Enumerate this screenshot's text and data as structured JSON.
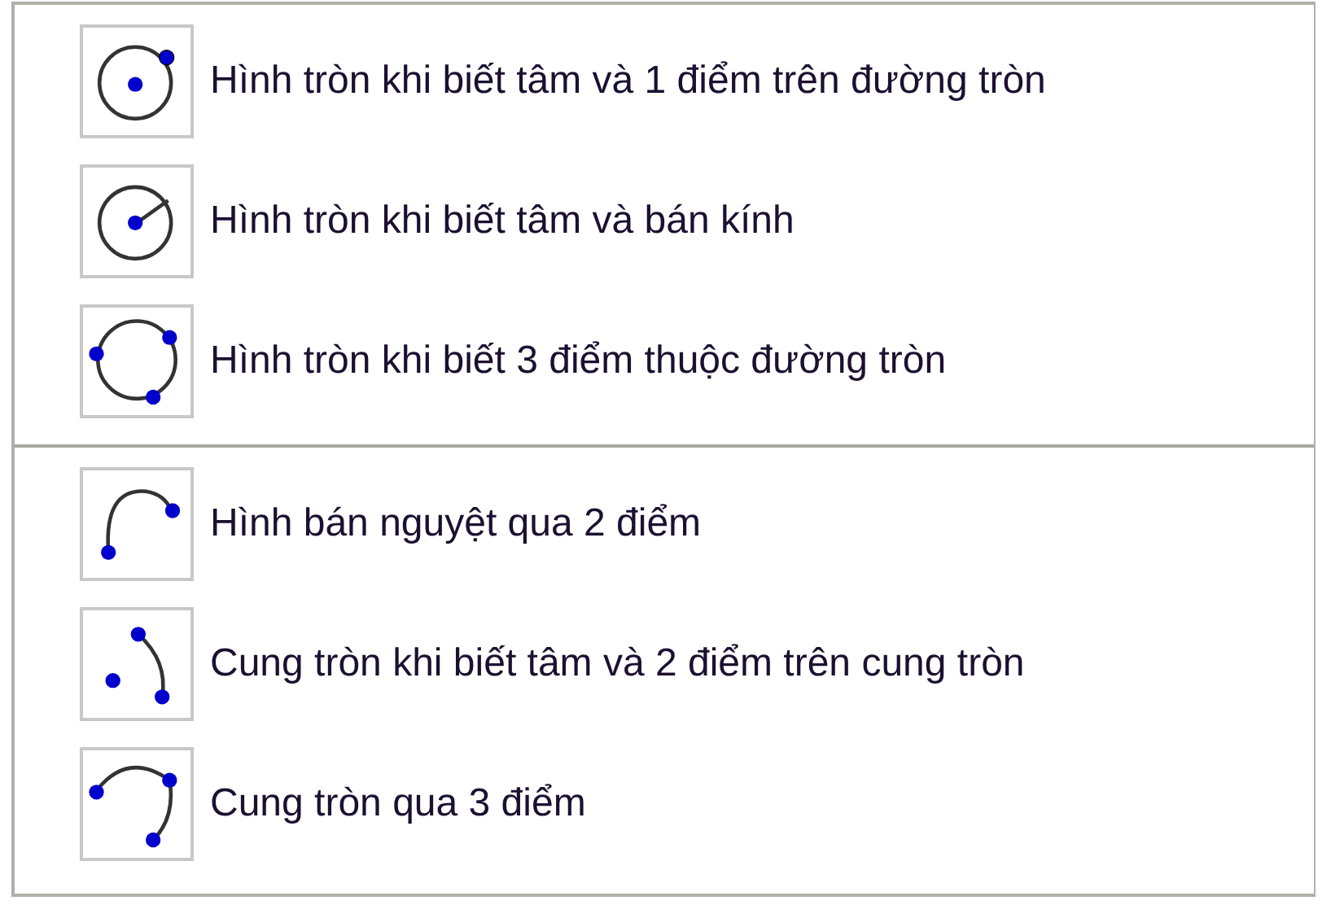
{
  "groups": [
    {
      "items": [
        {
          "kind": "circle-center-point",
          "label": "Hình tròn khi biết tâm và 1 điểm trên đường tròn"
        },
        {
          "kind": "circle-center-radius",
          "label": "Hình tròn khi biết tâm và bán kính"
        },
        {
          "kind": "circle-three-points",
          "label": "Hình tròn khi biết 3 điểm thuộc đường tròn"
        }
      ]
    },
    {
      "items": [
        {
          "kind": "semicircle",
          "label": "Hình bán nguyệt qua 2 điểm"
        },
        {
          "kind": "arc-center",
          "label": "Cung tròn khi biết tâm và 2 điểm trên cung tròn"
        },
        {
          "kind": "arc-three-points",
          "label": "Cung tròn qua 3 điểm"
        }
      ]
    }
  ]
}
